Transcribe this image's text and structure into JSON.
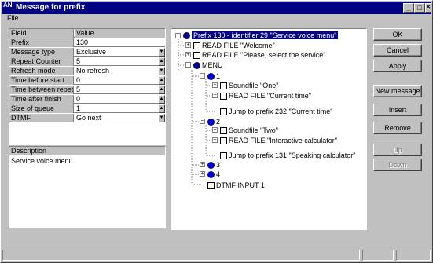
{
  "window": {
    "title": "Message for prefix",
    "app_icon_text": "AN",
    "minimize": "_",
    "maximize": "□",
    "close": "✕"
  },
  "menu": {
    "file": "File"
  },
  "properties": {
    "header_name": "Field",
    "header_value": "Value",
    "rows": [
      {
        "name": "Prefix",
        "value": "130"
      },
      {
        "name": "Message type",
        "value": "Exclusive"
      },
      {
        "name": "Repeat Counter",
        "value": "5"
      },
      {
        "name": "Refresh mode",
        "value": "No refresh"
      },
      {
        "name": "Time before start",
        "value": "0"
      },
      {
        "name": "Time between repeti",
        "value": "5"
      },
      {
        "name": "Time after finish",
        "value": "0"
      },
      {
        "name": "Size of queue",
        "value": "1"
      },
      {
        "name": "DTMF",
        "value": "Go next"
      }
    ]
  },
  "description": {
    "header": "Description",
    "text": "Service voice menu"
  },
  "tree": {
    "root": "Prefix 130 - identifier 29 \"Service voice menu\"",
    "read_welcome": "READ FILE \"Welcome\"",
    "read_select": "READ FILE \"Please, select the service\"",
    "menu": "MENU",
    "item1": "1",
    "sound1": "Soundfile \"One\"",
    "read_current": "READ FILE \"Current time\"",
    "jump1": "Jump to prefix 232 \"Current time\"",
    "item2": "2",
    "sound2": "Soundfile \"Two\"",
    "read_interactive": "READ FILE \"Interactive calculator\"",
    "jump2": "Jump to prefix 131 \"Speaking calculator\"",
    "item3": "3",
    "item4": "4",
    "dtmf": "DTMF INPUT 1"
  },
  "buttons": {
    "ok": "OK",
    "cancel": "Cancel",
    "apply": "Apply",
    "new_message": "New message",
    "insert": "Insert",
    "remove": "Remove",
    "up": "Up",
    "down": "Down"
  }
}
